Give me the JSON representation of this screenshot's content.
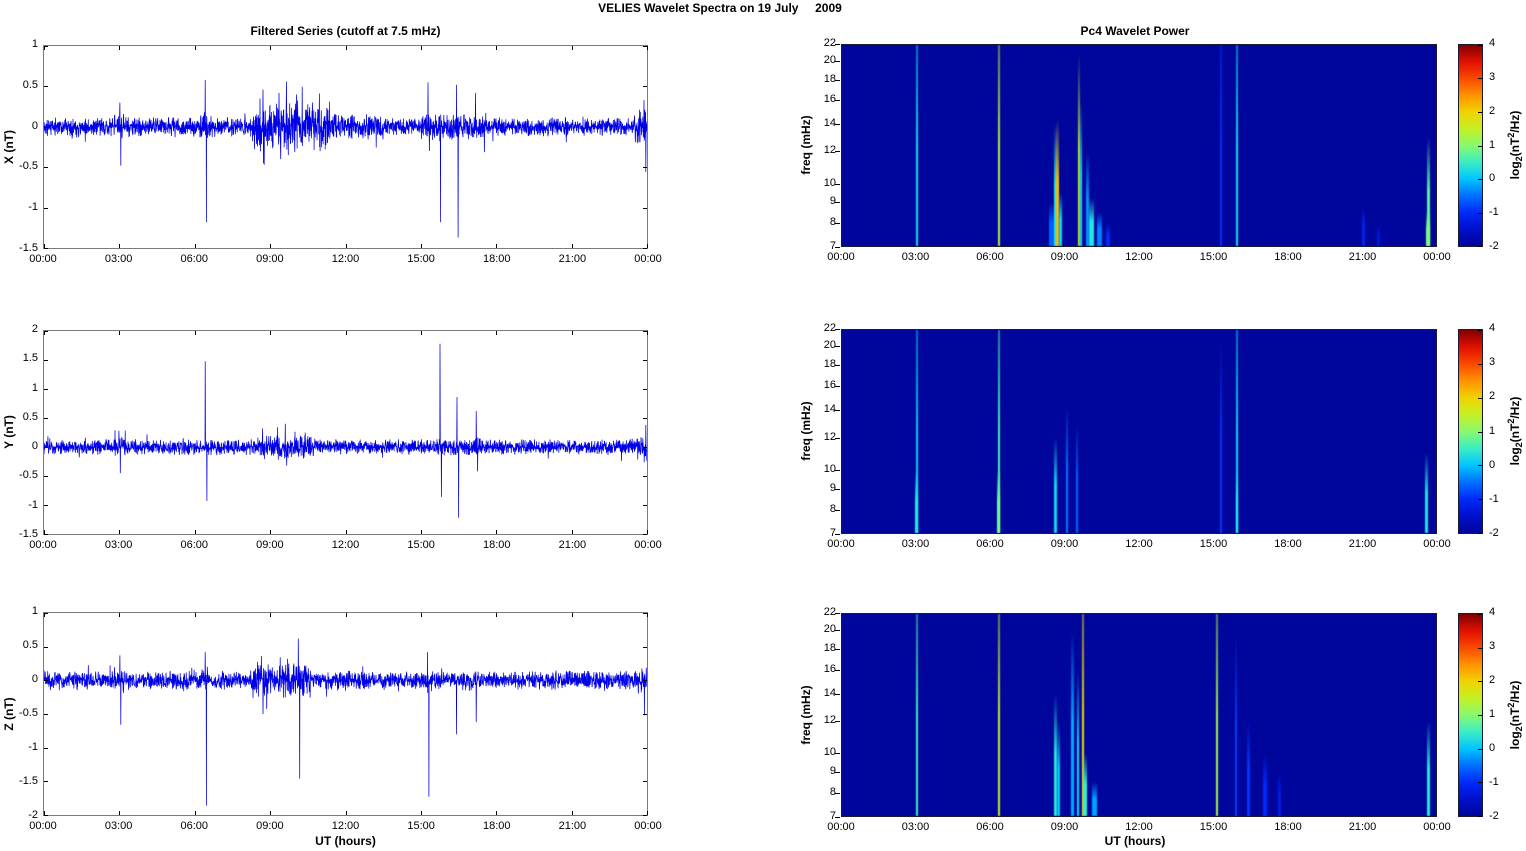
{
  "figure": {
    "title": "VELIES Wavelet Spectra on 19 July     2009"
  },
  "colors": {
    "series_line": "#0000e6",
    "spectrogram_background": "#00059b",
    "axis_border_timeseries": "#7a7a7a",
    "axis_border_spectrogram": "#1a1a33"
  },
  "colorbar_label": {
    "pre": "log",
    "sub": "2",
    "mid": "(nT",
    "sup": "2",
    "post": "/Hz)"
  },
  "chart_data": [
    {
      "type": "line",
      "id": "filtered_series_x",
      "title": "Filtered Series (cutoff at 7.5 mHz)",
      "ylabel": "X (nT)",
      "ylim": [
        -1.5,
        1
      ],
      "yticks": [
        "1",
        "0.5",
        "0",
        "-0.5",
        "-1",
        "-1.5"
      ],
      "ytick_values": [
        1,
        0.5,
        0,
        -0.5,
        -1,
        -1.5
      ],
      "xticks": [
        "00:00",
        "03:00",
        "06:00",
        "09:00",
        "12:00",
        "15:00",
        "18:00",
        "21:00",
        "00:00"
      ],
      "x_range_hours": [
        0,
        24
      ],
      "noise": {
        "base": 0.07,
        "segments": [
          [
            2.8,
            3.4,
            1.5
          ],
          [
            6.2,
            6.8,
            1.5
          ],
          [
            8.3,
            11.4,
            2.7
          ],
          [
            11.4,
            13.5,
            1.4
          ],
          [
            15.0,
            17.6,
            1.5
          ],
          [
            23.5,
            24,
            1.9
          ]
        ]
      },
      "spikes": [
        [
          3.02,
          0.3
        ],
        [
          3.06,
          -0.48
        ],
        [
          6.42,
          0.58
        ],
        [
          6.46,
          -1.18
        ],
        [
          8.6,
          0.35
        ],
        [
          8.72,
          0.46
        ],
        [
          8.76,
          -0.47
        ],
        [
          9.35,
          0.42
        ],
        [
          9.42,
          -0.4
        ],
        [
          9.65,
          0.56
        ],
        [
          9.72,
          -0.35
        ],
        [
          10.05,
          0.4
        ],
        [
          10.5,
          0.28
        ],
        [
          15.28,
          0.55
        ],
        [
          15.34,
          -0.3
        ],
        [
          15.78,
          -1.18
        ],
        [
          16.42,
          0.52
        ],
        [
          16.48,
          -1.37
        ],
        [
          17.18,
          0.42
        ],
        [
          23.88,
          0.33
        ],
        [
          23.95,
          -0.56
        ]
      ]
    },
    {
      "type": "heatmap",
      "id": "wavelet_power_x",
      "title": "Pc4 Wavelet Power",
      "ylabel": "freq (mHz)",
      "ylim": [
        7,
        22
      ],
      "yscale": "log",
      "yticks": [
        "22",
        "20",
        "18",
        "16",
        "14",
        "12",
        "10",
        "9",
        "8",
        "7"
      ],
      "ytick_values": [
        22,
        20,
        18,
        16,
        14,
        12,
        10,
        9,
        8,
        7
      ],
      "xticks": [
        "00:00",
        "03:00",
        "06:00",
        "09:00",
        "12:00",
        "15:00",
        "18:00",
        "21:00",
        "00:00"
      ],
      "x_range_hours": [
        0,
        24
      ],
      "colorbar": {
        "ticks": [
          "4",
          "3",
          "2",
          "1",
          "0",
          "-1",
          "-2"
        ],
        "tick_values": [
          4,
          3,
          2,
          1,
          0,
          -1,
          -2
        ],
        "lim": [
          -2,
          4
        ]
      },
      "streaks": [
        {
          "t": 3.0,
          "f_top": 22,
          "level": 0.25,
          "w": 2
        },
        {
          "t": 6.32,
          "f_top": 22,
          "level": 1.35,
          "w": 2.5
        },
        {
          "t": 8.45,
          "f_top": 9,
          "level": -0.6,
          "w": 6
        },
        {
          "t": 8.6,
          "f_top": 14,
          "level": 0.35,
          "w": 3
        },
        {
          "t": 8.68,
          "f_top": 14.5,
          "level": 2.2,
          "w": 2.5
        },
        {
          "t": 8.8,
          "f_top": 9.5,
          "level": 0.2,
          "w": 3
        },
        {
          "t": 9.55,
          "f_top": 21,
          "level": 1.5,
          "w": 2.5
        },
        {
          "t": 9.62,
          "f_top": 16,
          "level": 0.3,
          "w": 2
        },
        {
          "t": 9.9,
          "f_top": 12,
          "level": -0.3,
          "w": 3
        },
        {
          "t": 10.05,
          "f_top": 9.2,
          "level": 0.35,
          "w": 5
        },
        {
          "t": 10.35,
          "f_top": 8.5,
          "level": -0.4,
          "w": 5
        },
        {
          "t": 10.7,
          "f_top": 8,
          "level": -1.0,
          "w": 4
        },
        {
          "t": 15.25,
          "f_top": 22,
          "level": -0.9,
          "w": 2
        },
        {
          "t": 15.9,
          "f_top": 22,
          "level": 0.25,
          "w": 2
        },
        {
          "t": 21.0,
          "f_top": 8.8,
          "level": -1.1,
          "w": 3
        },
        {
          "t": 21.6,
          "f_top": 8,
          "level": -1.3,
          "w": 3
        },
        {
          "t": 23.6,
          "f_top": 13,
          "level": 0.7,
          "w": 3
        },
        {
          "t": 23.6,
          "f_top": 8.5,
          "level": 0.9,
          "w": 4
        }
      ]
    },
    {
      "type": "line",
      "id": "filtered_series_y",
      "title": "",
      "ylabel": "Y (nT)",
      "ylim": [
        -1.5,
        2
      ],
      "yticks": [
        "2",
        "1.5",
        "1",
        "0.5",
        "0",
        "-0.5",
        "-1",
        "-1.5"
      ],
      "ytick_values": [
        2,
        1.5,
        1,
        0.5,
        0,
        -0.5,
        -1,
        -1.5
      ],
      "xticks": [
        "00:00",
        "03:00",
        "06:00",
        "09:00",
        "12:00",
        "15:00",
        "18:00",
        "21:00",
        "00:00"
      ],
      "x_range_hours": [
        0,
        24
      ],
      "noise": {
        "base": 0.08,
        "segments": [
          [
            2.8,
            3.3,
            1.3
          ],
          [
            8.5,
            10.8,
            1.5
          ],
          [
            15.5,
            17.5,
            1.2
          ],
          [
            23.6,
            24,
            1.9
          ]
        ]
      },
      "spikes": [
        [
          2.98,
          0.28
        ],
        [
          3.04,
          -0.45
        ],
        [
          6.42,
          1.48
        ],
        [
          6.48,
          -0.93
        ],
        [
          8.7,
          0.32
        ],
        [
          9.3,
          0.34
        ],
        [
          9.6,
          0.4
        ],
        [
          9.66,
          -0.32
        ],
        [
          10.4,
          0.25
        ],
        [
          15.76,
          1.78
        ],
        [
          15.82,
          -0.86
        ],
        [
          16.44,
          0.86
        ],
        [
          16.5,
          -1.22
        ],
        [
          17.2,
          0.62
        ],
        [
          17.26,
          -0.42
        ],
        [
          23.95,
          0.38
        ]
      ]
    },
    {
      "type": "heatmap",
      "id": "wavelet_power_y",
      "title": "",
      "ylabel": "freq (mHz)",
      "ylim": [
        7,
        22
      ],
      "yscale": "log",
      "yticks": [
        "22",
        "20",
        "18",
        "16",
        "14",
        "12",
        "10",
        "9",
        "8",
        "7"
      ],
      "ytick_values": [
        22,
        20,
        18,
        16,
        14,
        12,
        10,
        9,
        8,
        7
      ],
      "xticks": [
        "00:00",
        "03:00",
        "06:00",
        "09:00",
        "12:00",
        "15:00",
        "18:00",
        "21:00",
        "00:00"
      ],
      "x_range_hours": [
        0,
        24
      ],
      "colorbar": {
        "ticks": [
          "4",
          "3",
          "2",
          "1",
          "0",
          "-1",
          "-2"
        ],
        "tick_values": [
          4,
          3,
          2,
          1,
          0,
          -1,
          -2
        ],
        "lim": [
          -2,
          4
        ]
      },
      "streaks": [
        {
          "t": 3.0,
          "f_top": 22,
          "level": 0.1,
          "w": 2
        },
        {
          "t": 3.0,
          "f_top": 10,
          "level": 0.35,
          "w": 2.5
        },
        {
          "t": 6.32,
          "f_top": 22,
          "level": 0.6,
          "w": 2.5
        },
        {
          "t": 6.32,
          "f_top": 10,
          "level": 0.8,
          "w": 3
        },
        {
          "t": 8.6,
          "f_top": 12,
          "level": 0.2,
          "w": 2.5
        },
        {
          "t": 9.05,
          "f_top": 14.5,
          "level": -0.45,
          "w": 2
        },
        {
          "t": 9.45,
          "f_top": 13,
          "level": -0.55,
          "w": 2
        },
        {
          "t": 15.25,
          "f_top": 21,
          "level": -0.85,
          "w": 2
        },
        {
          "t": 15.9,
          "f_top": 22,
          "level": 0.2,
          "w": 2
        },
        {
          "t": 15.9,
          "f_top": 10,
          "level": 0.3,
          "w": 2.5
        },
        {
          "t": 23.55,
          "f_top": 11,
          "level": 0.35,
          "w": 3
        }
      ]
    },
    {
      "type": "line",
      "id": "filtered_series_z",
      "title": "",
      "ylabel": "Z (nT)",
      "ylim": [
        -2,
        1
      ],
      "yticks": [
        "1",
        "0.5",
        "0",
        "-0.5",
        "-1",
        "-1.5",
        "-2"
      ],
      "ytick_values": [
        1,
        0.5,
        0,
        -0.5,
        -1,
        -1.5,
        -2
      ],
      "xticks": [
        "00:00",
        "03:00",
        "06:00",
        "09:00",
        "12:00",
        "15:00",
        "18:00",
        "21:00",
        "00:00"
      ],
      "x_range_hours": [
        0,
        24
      ],
      "xlabel": "UT (hours)",
      "noise": {
        "base": 0.085,
        "segments": [
          [
            2.8,
            3.3,
            1.3
          ],
          [
            6.2,
            6.6,
            1.3
          ],
          [
            8.3,
            10.6,
            1.9
          ],
          [
            23.6,
            24,
            1.5
          ]
        ]
      },
      "spikes": [
        [
          3.02,
          0.37
        ],
        [
          3.06,
          -0.66
        ],
        [
          6.42,
          0.42
        ],
        [
          6.46,
          -1.86
        ],
        [
          8.65,
          0.36
        ],
        [
          8.72,
          -0.5
        ],
        [
          9.4,
          0.34
        ],
        [
          9.7,
          0.32
        ],
        [
          10.12,
          0.62
        ],
        [
          10.18,
          -1.46
        ],
        [
          15.26,
          0.42
        ],
        [
          15.32,
          -1.73
        ],
        [
          16.42,
          -0.8
        ],
        [
          17.2,
          -0.62
        ],
        [
          23.9,
          -0.52
        ]
      ]
    },
    {
      "type": "heatmap",
      "id": "wavelet_power_z",
      "title": "",
      "ylabel": "freq (mHz)",
      "ylim": [
        7,
        22
      ],
      "yscale": "log",
      "yticks": [
        "22",
        "20",
        "18",
        "16",
        "14",
        "12",
        "10",
        "9",
        "8",
        "7"
      ],
      "ytick_values": [
        22,
        20,
        18,
        16,
        14,
        12,
        10,
        9,
        8,
        7
      ],
      "xticks": [
        "00:00",
        "03:00",
        "06:00",
        "09:00",
        "12:00",
        "15:00",
        "18:00",
        "21:00",
        "00:00"
      ],
      "x_range_hours": [
        0,
        24
      ],
      "xlabel": "UT (hours)",
      "colorbar": {
        "ticks": [
          "4",
          "3",
          "2",
          "1",
          "0",
          "-1",
          "-2"
        ],
        "tick_values": [
          4,
          3,
          2,
          1,
          0,
          -1,
          -2
        ],
        "lim": [
          -2,
          4
        ]
      },
      "streaks": [
        {
          "t": 3.0,
          "f_top": 22,
          "level": 0.55,
          "w": 2
        },
        {
          "t": 6.32,
          "f_top": 22,
          "level": 1.45,
          "w": 2.5
        },
        {
          "t": 8.6,
          "f_top": 14,
          "level": 0.4,
          "w": 3
        },
        {
          "t": 8.7,
          "f_top": 12,
          "level": 0.0,
          "w": 3
        },
        {
          "t": 9.3,
          "f_top": 20,
          "level": -0.15,
          "w": 3
        },
        {
          "t": 9.5,
          "f_top": 16,
          "level": 0.2,
          "w": 2
        },
        {
          "t": 9.7,
          "f_top": 22,
          "level": 1.9,
          "w": 2.5
        },
        {
          "t": 9.8,
          "f_top": 10,
          "level": 0.5,
          "w": 4
        },
        {
          "t": 10.15,
          "f_top": 8.5,
          "level": -0.2,
          "w": 5
        },
        {
          "t": 15.1,
          "f_top": 22,
          "level": 1.25,
          "w": 2
        },
        {
          "t": 15.85,
          "f_top": 20,
          "level": -0.8,
          "w": 2
        },
        {
          "t": 16.35,
          "f_top": 12,
          "level": -0.85,
          "w": 3
        },
        {
          "t": 17.05,
          "f_top": 10,
          "level": -1.0,
          "w": 4
        },
        {
          "t": 17.6,
          "f_top": 9,
          "level": -1.2,
          "w": 3
        },
        {
          "t": 23.6,
          "f_top": 12,
          "level": 0.4,
          "w": 3
        }
      ]
    }
  ]
}
